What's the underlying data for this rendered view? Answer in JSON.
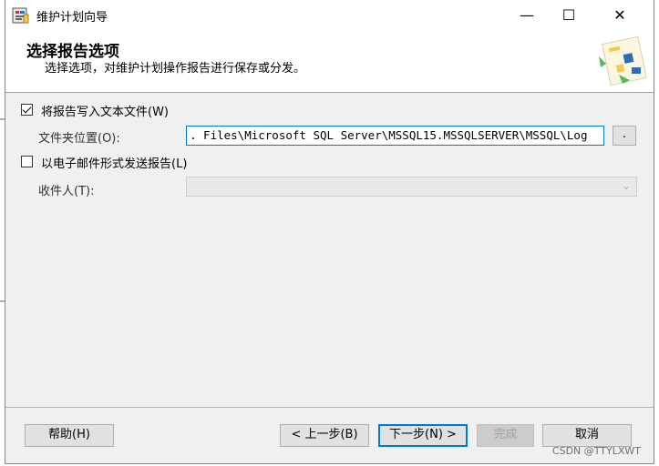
{
  "window": {
    "title": "维护计划向导",
    "controls": {
      "minimize": "—",
      "maximize": "☐",
      "close": "✕"
    }
  },
  "header": {
    "title": "选择报告选项",
    "subtitle": "选择选项，对维护计划操作报告进行保存或分发。",
    "art_icon": "report-options-icon"
  },
  "options": {
    "write_report": {
      "label": "将报告写入文本文件(W)",
      "checked": true
    },
    "folder_location": {
      "label": "文件夹位置(O):",
      "value": ". Files\\Microsoft SQL Server\\MSSQL15.MSSQLSERVER\\MSSQL\\Log",
      "browse_label": "."
    },
    "email_report": {
      "label": "以电子邮件形式发送报告(L)",
      "checked": false
    },
    "recipient": {
      "label": "收件人(T):",
      "value": "",
      "enabled": false
    }
  },
  "footer": {
    "help": "帮助(H)",
    "prev": "< 上一步(B)",
    "next": "下一步(N) >",
    "finish": "完成",
    "cancel": "取消"
  },
  "watermark": "CSDN @TTYLXWT",
  "colors": {
    "accent": "#0078d7",
    "header_bg": "#ffffff",
    "body_bg": "#f0f0f0"
  }
}
